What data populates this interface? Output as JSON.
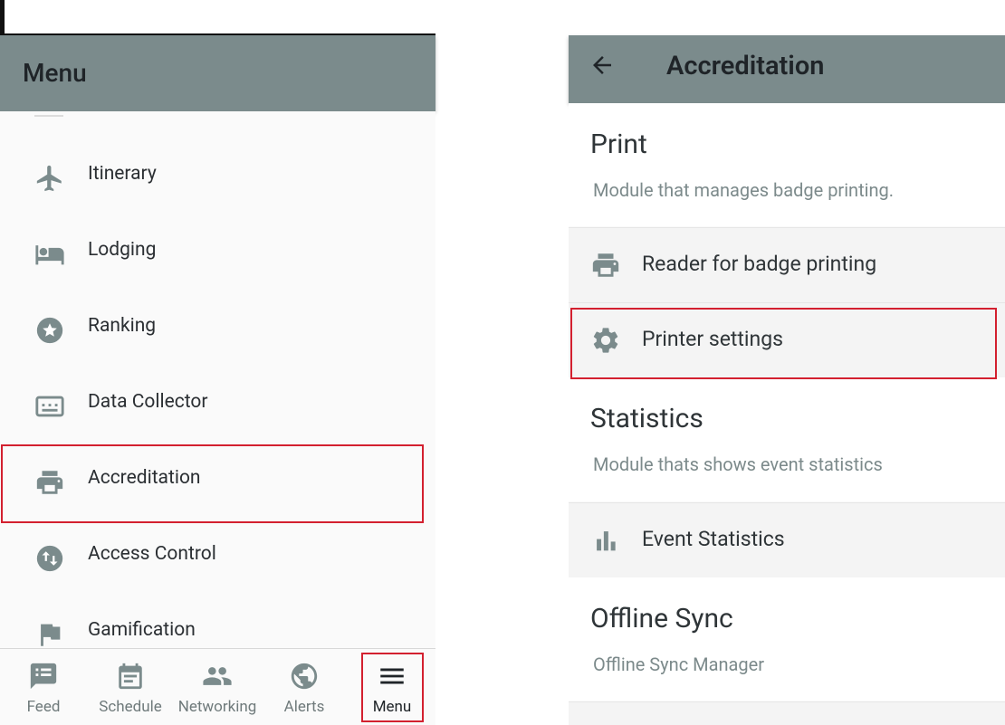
{
  "left": {
    "appbar": {
      "title": "Menu"
    },
    "items": [
      {
        "label": "Itinerary",
        "icon": "airplane-icon"
      },
      {
        "label": "Lodging",
        "icon": "bed-icon"
      },
      {
        "label": "Ranking",
        "icon": "star-badge-icon"
      },
      {
        "label": "Data Collector",
        "icon": "keyboard-icon"
      },
      {
        "label": "Accreditation",
        "icon": "printer-icon"
      },
      {
        "label": "Access Control",
        "icon": "swap-vertical-icon"
      },
      {
        "label": "Gamification",
        "icon": "flag-icon"
      }
    ],
    "bottom_nav": [
      {
        "label": "Feed",
        "icon": "feed-icon"
      },
      {
        "label": "Schedule",
        "icon": "calendar-icon"
      },
      {
        "label": "Networking",
        "icon": "people-icon"
      },
      {
        "label": "Alerts",
        "icon": "globe-icon"
      },
      {
        "label": "Menu",
        "icon": "hamburger-icon"
      }
    ]
  },
  "right": {
    "appbar": {
      "title": "Accreditation",
      "back_icon": "back-arrow-icon"
    },
    "sections": [
      {
        "title": "Print",
        "subtitle": "Module that manages badge printing.",
        "rows": [
          {
            "label": "Reader for badge printing",
            "icon": "printer-icon"
          },
          {
            "label": "Printer settings",
            "icon": "gear-icon"
          }
        ]
      },
      {
        "title": "Statistics",
        "subtitle": "Module thats shows event statistics",
        "rows": [
          {
            "label": "Event Statistics",
            "icon": "bar-chart-icon"
          }
        ]
      },
      {
        "title": "Offline Sync",
        "subtitle": "Offline Sync Manager",
        "rows": []
      }
    ]
  },
  "colors": {
    "appbar": "#7b8b8c",
    "icon": "#7b8b8c",
    "highlight": "#d3202f",
    "text": "#2b2f33",
    "subtext": "#7c8a8b"
  }
}
